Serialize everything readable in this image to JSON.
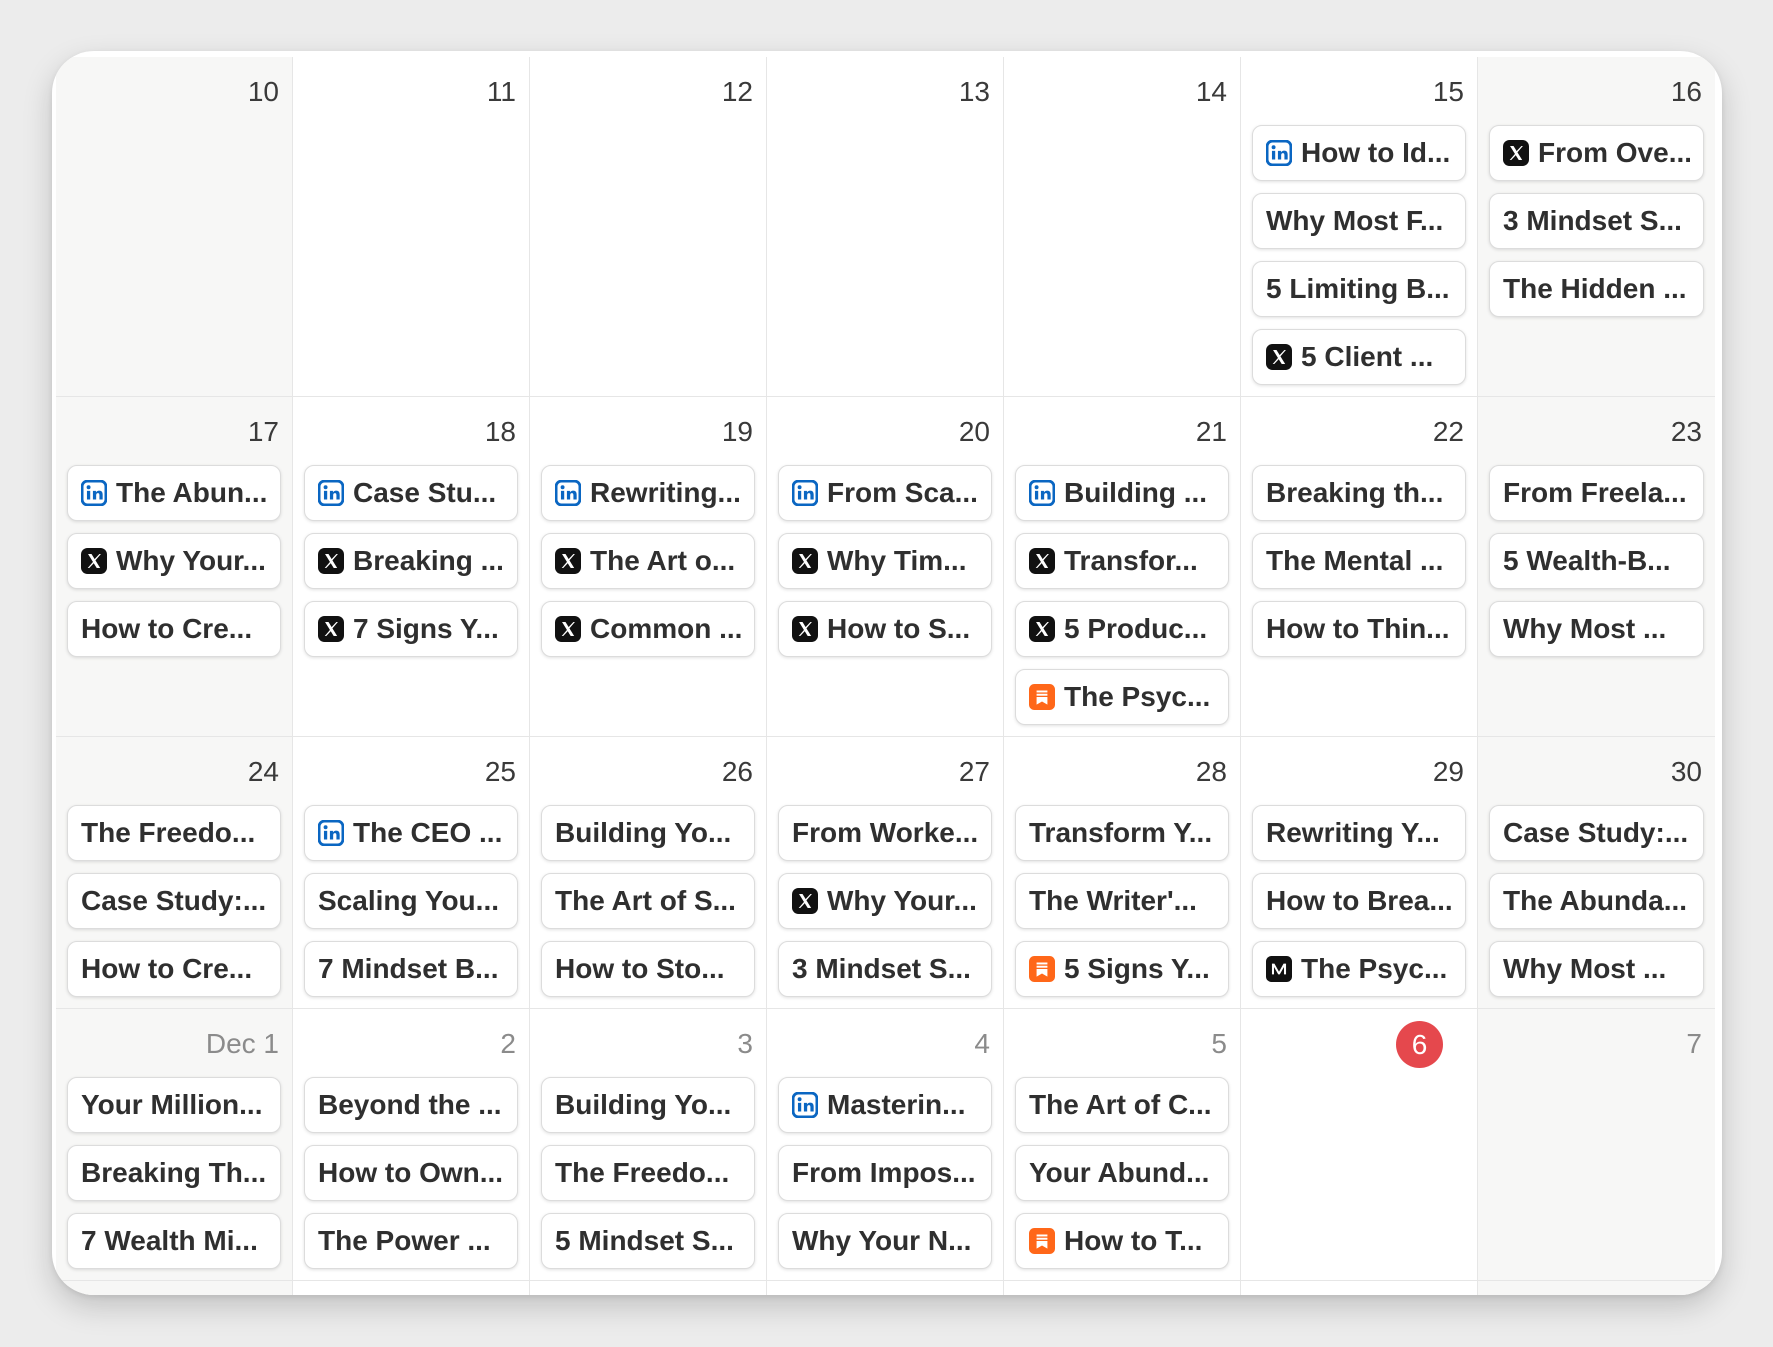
{
  "colors": {
    "today": "#e5484d",
    "linkedin": "#0a66c2",
    "x": "#111111",
    "substack": "#ff6719",
    "medium": "#111111"
  },
  "weeks": [
    {
      "days": [
        {
          "label": "10",
          "events": []
        },
        {
          "label": "11",
          "events": []
        },
        {
          "label": "12",
          "events": []
        },
        {
          "label": "13",
          "events": []
        },
        {
          "label": "14",
          "events": []
        },
        {
          "label": "15",
          "events": [
            {
              "icon": "linkedin-icon",
              "title": "How to Id..."
            },
            {
              "icon": "",
              "title": "Why Most F..."
            },
            {
              "icon": "",
              "title": "5 Limiting B..."
            },
            {
              "icon": "x-icon",
              "title": "5 Client ..."
            }
          ]
        },
        {
          "label": "16",
          "events": [
            {
              "icon": "x-icon",
              "title": "From Ove..."
            },
            {
              "icon": "",
              "title": "3 Mindset S..."
            },
            {
              "icon": "",
              "title": "The Hidden ..."
            }
          ]
        }
      ]
    },
    {
      "days": [
        {
          "label": "17",
          "events": [
            {
              "icon": "linkedin-icon",
              "title": "The Abun..."
            },
            {
              "icon": "x-icon",
              "title": "Why Your..."
            },
            {
              "icon": "",
              "title": "How to Cre..."
            }
          ]
        },
        {
          "label": "18",
          "events": [
            {
              "icon": "linkedin-icon",
              "title": "Case Stu..."
            },
            {
              "icon": "x-icon",
              "title": "Breaking ..."
            },
            {
              "icon": "x-icon",
              "title": "7 Signs Y..."
            }
          ]
        },
        {
          "label": "19",
          "events": [
            {
              "icon": "linkedin-icon",
              "title": "Rewriting..."
            },
            {
              "icon": "x-icon",
              "title": "The Art o..."
            },
            {
              "icon": "x-icon",
              "title": "Common ..."
            }
          ]
        },
        {
          "label": "20",
          "events": [
            {
              "icon": "linkedin-icon",
              "title": "From Sca..."
            },
            {
              "icon": "x-icon",
              "title": "Why Tim..."
            },
            {
              "icon": "x-icon",
              "title": "How to S..."
            }
          ]
        },
        {
          "label": "21",
          "events": [
            {
              "icon": "linkedin-icon",
              "title": "Building ..."
            },
            {
              "icon": "x-icon",
              "title": "Transfor..."
            },
            {
              "icon": "x-icon",
              "title": "5 Produc..."
            },
            {
              "icon": "substack-icon",
              "title": "The Psyc..."
            }
          ]
        },
        {
          "label": "22",
          "events": [
            {
              "icon": "",
              "title": "Breaking th..."
            },
            {
              "icon": "",
              "title": "The Mental ..."
            },
            {
              "icon": "",
              "title": "How to Thin..."
            }
          ]
        },
        {
          "label": "23",
          "events": [
            {
              "icon": "",
              "title": "From Freela..."
            },
            {
              "icon": "",
              "title": "5 Wealth-B..."
            },
            {
              "icon": "",
              "title": "Why Most ..."
            }
          ]
        }
      ]
    },
    {
      "days": [
        {
          "label": "24",
          "events": [
            {
              "icon": "",
              "title": "The Freedo..."
            },
            {
              "icon": "",
              "title": "Case Study:..."
            },
            {
              "icon": "",
              "title": "How to Cre..."
            }
          ]
        },
        {
          "label": "25",
          "events": [
            {
              "icon": "linkedin-icon",
              "title": "The CEO ..."
            },
            {
              "icon": "",
              "title": "Scaling You..."
            },
            {
              "icon": "",
              "title": "7 Mindset B..."
            }
          ]
        },
        {
          "label": "26",
          "events": [
            {
              "icon": "",
              "title": "Building Yo..."
            },
            {
              "icon": "",
              "title": "The Art of S..."
            },
            {
              "icon": "",
              "title": "How to Sto..."
            }
          ]
        },
        {
          "label": "27",
          "events": [
            {
              "icon": "",
              "title": "From Worke..."
            },
            {
              "icon": "x-icon",
              "title": "Why Your..."
            },
            {
              "icon": "",
              "title": "3 Mindset S..."
            }
          ]
        },
        {
          "label": "28",
          "events": [
            {
              "icon": "",
              "title": "Transform Y..."
            },
            {
              "icon": "",
              "title": "The Writer'..."
            },
            {
              "icon": "substack-icon",
              "title": "5 Signs Y..."
            }
          ]
        },
        {
          "label": "29",
          "events": [
            {
              "icon": "",
              "title": "Rewriting Y..."
            },
            {
              "icon": "",
              "title": "How to Brea..."
            },
            {
              "icon": "medium-icon",
              "title": "The Psyc..."
            }
          ]
        },
        {
          "label": "30",
          "events": [
            {
              "icon": "",
              "title": "Case Study:..."
            },
            {
              "icon": "",
              "title": "The Abunda..."
            },
            {
              "icon": "",
              "title": "Why Most ..."
            }
          ]
        }
      ]
    },
    {
      "days": [
        {
          "label": "Dec 1",
          "events": [
            {
              "icon": "",
              "title": "Your Million..."
            },
            {
              "icon": "",
              "title": "Breaking Th..."
            },
            {
              "icon": "",
              "title": "7 Wealth Mi..."
            }
          ]
        },
        {
          "label": "2",
          "events": [
            {
              "icon": "",
              "title": "Beyond the ..."
            },
            {
              "icon": "",
              "title": "How to Own..."
            },
            {
              "icon": "",
              "title": "The Power ..."
            }
          ]
        },
        {
          "label": "3",
          "events": [
            {
              "icon": "",
              "title": "Building Yo..."
            },
            {
              "icon": "",
              "title": "The Freedo..."
            },
            {
              "icon": "",
              "title": "5 Mindset S..."
            }
          ]
        },
        {
          "label": "4",
          "events": [
            {
              "icon": "linkedin-icon",
              "title": "Masterin..."
            },
            {
              "icon": "",
              "title": "From Impos..."
            },
            {
              "icon": "",
              "title": "Why Your N..."
            }
          ]
        },
        {
          "label": "5",
          "events": [
            {
              "icon": "",
              "title": "The Art of C..."
            },
            {
              "icon": "",
              "title": "Your Abund..."
            },
            {
              "icon": "substack-icon",
              "title": "How to T..."
            }
          ]
        },
        {
          "label": "6",
          "today": true,
          "events": []
        },
        {
          "label": "7",
          "events": []
        }
      ]
    }
  ]
}
